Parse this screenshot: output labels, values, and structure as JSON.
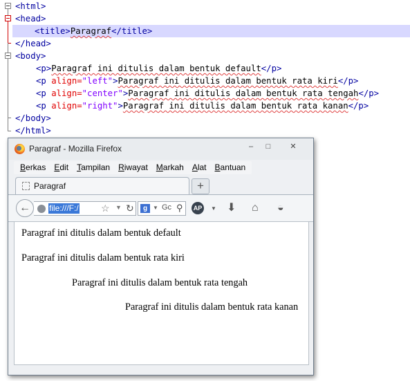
{
  "editor": {
    "lines": [
      {
        "l1": "<html>"
      },
      {
        "l2": "<head>"
      },
      {
        "title_open": "<title>",
        "title_text": "Paragraf",
        "title_close": "</title>"
      },
      {
        "l4": "</head>"
      },
      {
        "l5": "<body>"
      },
      {
        "p_open": "<p>",
        "p_text": "Paragraf ini ditulis dalam bentuk default",
        "p_close": "</p>"
      },
      {
        "p_tag": "<p ",
        "attr": "align=",
        "val": "\"left\"",
        "gt": ">",
        "p_text": "Paragraf ini ditulis dalam bentuk rata kiri",
        "p_close": "</p>"
      },
      {
        "p_tag": "<p ",
        "attr": "align=",
        "val": "\"center\"",
        "gt": ">",
        "p_text": "Paragraf ini ditulis dalam bentuk rata tengah",
        "p_close": "</p>"
      },
      {
        "p_tag": "<p ",
        "attr": "align=",
        "val": "\"right\"",
        "gt": ">",
        "p_text": "Paragraf ini ditulis dalam bentuk rata kanan",
        "p_close": "</p>"
      },
      {
        "l10": "</body>"
      },
      {
        "l11": "</html>"
      }
    ]
  },
  "browser": {
    "window_title": "Paragraf - Mozilla Firefox",
    "window_buttons": {
      "minimize": "–",
      "maximize": "□",
      "close": "✕"
    },
    "menu": [
      "Berkas",
      "Edit",
      "Tampilan",
      "Riwayat",
      "Markah",
      "Alat",
      "Bantuan"
    ],
    "tab_title": "Paragraf",
    "new_tab": "+",
    "url": "file:///F:/",
    "search_placeholder": "Gc",
    "icons": {
      "back": "back-arrow-icon",
      "globe": "globe-icon",
      "star": "bookmark-star-icon",
      "reload": "reload-icon",
      "search_engine": "google-icon",
      "search": "search-icon",
      "addon": "addon-icon",
      "download": "download-icon",
      "home": "home-icon",
      "pocket": "pocket-icon"
    },
    "paragraphs": [
      "Paragraf ini ditulis dalam bentuk default",
      "Paragraf ini ditulis dalam bentuk rata kiri",
      "Paragraf ini ditulis dalam bentuk rata tengah",
      "Paragraf ini ditulis dalam bentuk rata kanan"
    ]
  }
}
